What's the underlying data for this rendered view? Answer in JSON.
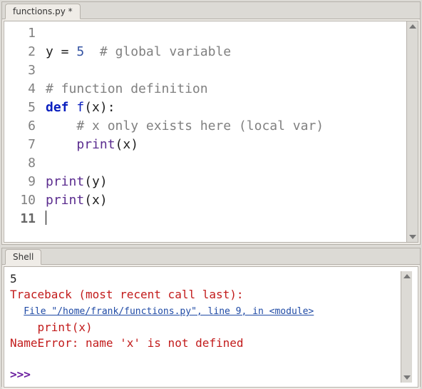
{
  "editor": {
    "tab_label": "functions.py *",
    "line_numbers": [
      "1",
      "2",
      "3",
      "4",
      "5",
      "6",
      "7",
      "8",
      "9",
      "10",
      "11"
    ],
    "current_line_index": 10,
    "lines": {
      "l1": "",
      "l2": {
        "pre": "y = ",
        "num": "5",
        "post": "  ",
        "comment": "# global variable"
      },
      "l3": "",
      "l4": {
        "comment": "# function definition"
      },
      "l5": {
        "kw": "def",
        "sp": " ",
        "fn": "f",
        "open": "(",
        "arg": "x",
        "close": ")",
        "colon": ":"
      },
      "l6": {
        "indent": "    ",
        "comment": "# x only exists here (local var)"
      },
      "l7": {
        "indent": "    ",
        "builtin": "print",
        "open": "(",
        "arg": "x",
        "close": ")"
      },
      "l8": "",
      "l9": {
        "builtin": "print",
        "open": "(",
        "arg": "y",
        "close": ")"
      },
      "l10": {
        "builtin": "print",
        "open": "(",
        "arg": "x",
        "close": ")"
      },
      "l11": ""
    }
  },
  "shell": {
    "tab_label": "Shell",
    "output_value": "5",
    "traceback_header": "Traceback (most recent call last):",
    "file_link_indent": "  ",
    "file_link": "File \"/home/frank/functions.py\", line 9, in <module>",
    "err_context_indent": "    ",
    "err_context": "print(x)",
    "err_message": "NameError: name 'x' is not defined",
    "prompt": ">>> "
  }
}
